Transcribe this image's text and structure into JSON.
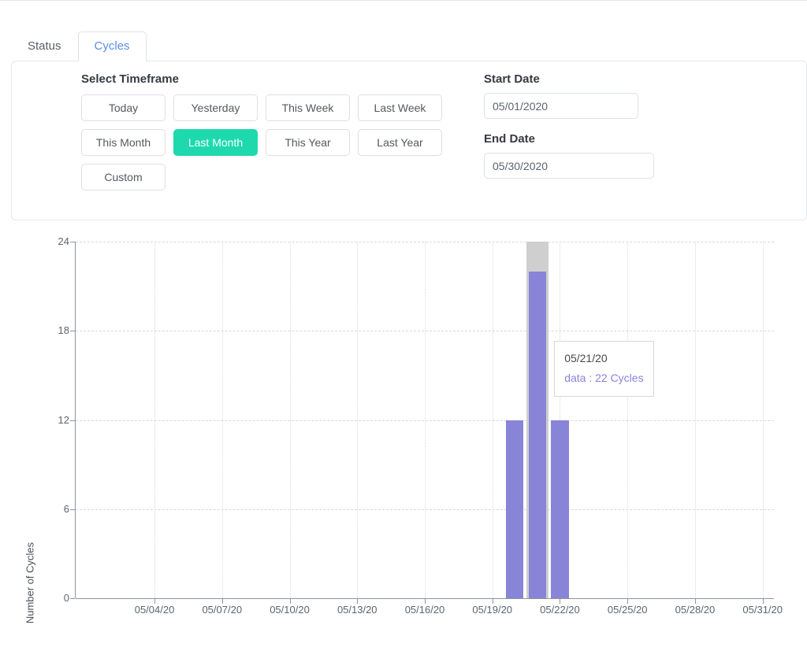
{
  "tabs": [
    {
      "label": "Status",
      "active": false
    },
    {
      "label": "Cycles",
      "active": true
    }
  ],
  "filters": {
    "timeframe_title": "Select Timeframe",
    "buttons": [
      {
        "label": "Today",
        "selected": false
      },
      {
        "label": "Yesterday",
        "selected": false
      },
      {
        "label": "This Week",
        "selected": false
      },
      {
        "label": "Last Week",
        "selected": false
      },
      {
        "label": "This Month",
        "selected": false
      },
      {
        "label": "Last Month",
        "selected": true
      },
      {
        "label": "This Year",
        "selected": false
      },
      {
        "label": "Last Year",
        "selected": false
      },
      {
        "label": "Custom",
        "selected": false
      }
    ],
    "start_date_label": "Start Date",
    "start_date_value": "05/01/2020",
    "start_date_placeholder": "MM/DD/YYYY",
    "end_date_label": "End Date",
    "end_date_value": "05/30/2020",
    "end_date_placeholder": "MM/DD/YYYY",
    "selected_color": "#1ed9ae"
  },
  "tooltip": {
    "date": "05/21/20",
    "value_line": "data : 22 Cycles"
  },
  "chart_data": {
    "type": "bar",
    "title": "",
    "xlabel": "",
    "ylabel": "Number of Cycles",
    "ylim": [
      0,
      24
    ],
    "yticks": [
      0,
      6,
      12,
      18,
      24
    ],
    "xticks": [
      "05/04/20",
      "05/07/20",
      "05/10/20",
      "05/13/20",
      "05/16/20",
      "05/19/20",
      "05/22/20",
      "05/25/20",
      "05/28/20",
      "05/31/20"
    ],
    "x_domain": [
      "05/01/20",
      "05/31/20"
    ],
    "grid": true,
    "legend": false,
    "series_color": "#8884d8",
    "highlight_color": "#cfcfcf",
    "highlighted_category": "05/21/20",
    "categories": [
      "05/01/20",
      "05/02/20",
      "05/03/20",
      "05/04/20",
      "05/05/20",
      "05/06/20",
      "05/07/20",
      "05/08/20",
      "05/09/20",
      "05/10/20",
      "05/11/20",
      "05/12/20",
      "05/13/20",
      "05/14/20",
      "05/15/20",
      "05/16/20",
      "05/17/20",
      "05/18/20",
      "05/19/20",
      "05/20/20",
      "05/21/20",
      "05/22/20",
      "05/23/20",
      "05/24/20",
      "05/25/20",
      "05/26/20",
      "05/27/20",
      "05/28/20",
      "05/29/20",
      "05/30/20",
      "05/31/20"
    ],
    "values": [
      0,
      0,
      0,
      0,
      0,
      0,
      0,
      0,
      0,
      0,
      0,
      0,
      0,
      0,
      0,
      0,
      0,
      0,
      0,
      12,
      22,
      12,
      0,
      0,
      0,
      0,
      0,
      0,
      0,
      0,
      0
    ],
    "series": [
      {
        "name": "data",
        "unit": "Cycles",
        "values": [
          0,
          0,
          0,
          0,
          0,
          0,
          0,
          0,
          0,
          0,
          0,
          0,
          0,
          0,
          0,
          0,
          0,
          0,
          0,
          12,
          22,
          12,
          0,
          0,
          0,
          0,
          0,
          0,
          0,
          0,
          0
        ]
      }
    ]
  }
}
